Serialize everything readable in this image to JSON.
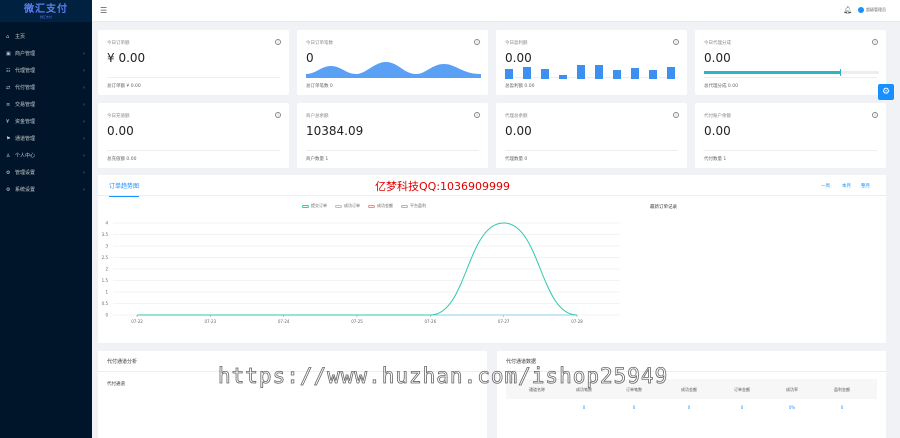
{
  "brand": {
    "name": "微汇支付",
    "sub": "微汇支付"
  },
  "sidebar": {
    "items": [
      {
        "label": "主页",
        "icon": "home-icon",
        "glyph": "⌂",
        "arrow": false
      },
      {
        "label": "商户管理",
        "icon": "merchant-icon",
        "glyph": "▣",
        "arrow": true
      },
      {
        "label": "代理管理",
        "icon": "agent-icon",
        "glyph": "☷",
        "arrow": true
      },
      {
        "label": "代付管理",
        "icon": "payout-icon",
        "glyph": "⇄",
        "arrow": true
      },
      {
        "label": "交易管理",
        "icon": "trade-icon",
        "glyph": "≡",
        "arrow": true
      },
      {
        "label": "资金管理",
        "icon": "funds-icon",
        "glyph": "¥",
        "arrow": true
      },
      {
        "label": "通道管理",
        "icon": "channel-icon",
        "glyph": "⚑",
        "arrow": true
      },
      {
        "label": "个人中心",
        "icon": "user-icon",
        "glyph": "♙",
        "arrow": true
      },
      {
        "label": "管理设置",
        "icon": "admin-settings-icon",
        "glyph": "⚙",
        "arrow": true
      },
      {
        "label": "系统设置",
        "icon": "system-settings-icon",
        "glyph": "⚙",
        "arrow": true
      }
    ]
  },
  "header": {
    "user": "超级管理员"
  },
  "cards": [
    {
      "label": "今日订单额",
      "value": "¥ 0.00",
      "foot": "总订单额 ¥ 0.00"
    },
    {
      "label": "今日订单笔数",
      "value": "0",
      "foot": "总订单笔数 0"
    },
    {
      "label": "今日盈利额",
      "value": "0.00",
      "foot": "总盈利额 0.00"
    },
    {
      "label": "今日代理分成",
      "value": "0.00",
      "foot": "总代理分成 0.00",
      "progress": 0.78
    },
    {
      "label": "今日充值额",
      "value": "0.00",
      "foot": "总充值额 0.00"
    },
    {
      "label": "商户总余额",
      "value": "10384.09",
      "foot": "商户数量 1"
    },
    {
      "label": "代理总余额",
      "value": "0.00",
      "foot": "代理数量 0"
    },
    {
      "label": "代付账户余额",
      "value": "0.00",
      "foot": "代付数量 1"
    }
  ],
  "trend": {
    "tab": "订单趋势图",
    "watermark_qq": "亿梦科技QQ:1036909999",
    "ranges": [
      "一周",
      "本月",
      "整月"
    ],
    "recent_title": "最新订单记录"
  },
  "chart_data": {
    "type": "line",
    "x": [
      "07-22",
      "07-23",
      "07-24",
      "07-25",
      "07-26",
      "07-27",
      "07-28"
    ],
    "ylim": [
      0,
      4
    ],
    "yticks": [
      "0",
      "0.5",
      "1",
      "1.5",
      "2",
      "2.5",
      "3",
      "3.5",
      "4"
    ],
    "series": [
      {
        "name": "提交订单",
        "color": "#2ec7b0",
        "values": [
          0,
          0,
          0,
          0,
          0,
          4,
          0
        ]
      },
      {
        "name": "成功订单",
        "color": "#8fd0e6",
        "values": [
          0,
          0,
          0,
          0,
          0,
          0,
          0
        ]
      },
      {
        "name": "成功金额",
        "color": "#f28b8b",
        "values": [
          0,
          0,
          0,
          0,
          0,
          0,
          0
        ]
      },
      {
        "name": "平台盈利",
        "color": "#f5a55a",
        "values": [
          0,
          0,
          0,
          0,
          0,
          0,
          0
        ]
      }
    ]
  },
  "bottom_left": {
    "title": "代付通道分析",
    "sub": "代付通道"
  },
  "bottom_right": {
    "title": "代付通道数据",
    "columns": [
      "通道名称",
      "成功笔数",
      "订单笔数",
      "成功金额",
      "订单金额",
      "成功率",
      "盈利金额"
    ],
    "row": [
      "",
      "0",
      "0",
      "0",
      "0",
      "0%",
      "0"
    ]
  },
  "watermark": "https://www.huzhan.com/ishop25949"
}
